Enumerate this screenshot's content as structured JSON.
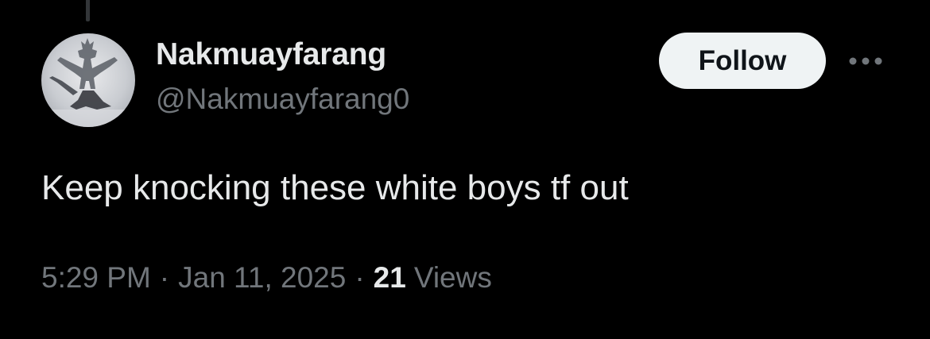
{
  "author": {
    "display_name": "Nakmuayfarang",
    "handle": "@Nakmuayfarang0"
  },
  "actions": {
    "follow_label": "Follow",
    "more_icon": "more-horizontal-icon"
  },
  "tweet": {
    "text": "Keep knocking these white boys tf out"
  },
  "meta": {
    "time": "5:29 PM",
    "separator": "·",
    "date": "Jan 11, 2025",
    "views_count": "21",
    "views_label": "Views"
  },
  "colors": {
    "background": "#000000",
    "primary_text": "#e7e9ea",
    "secondary_text": "#71767b",
    "button_bg": "#eff3f4",
    "button_text": "#0f1419"
  }
}
